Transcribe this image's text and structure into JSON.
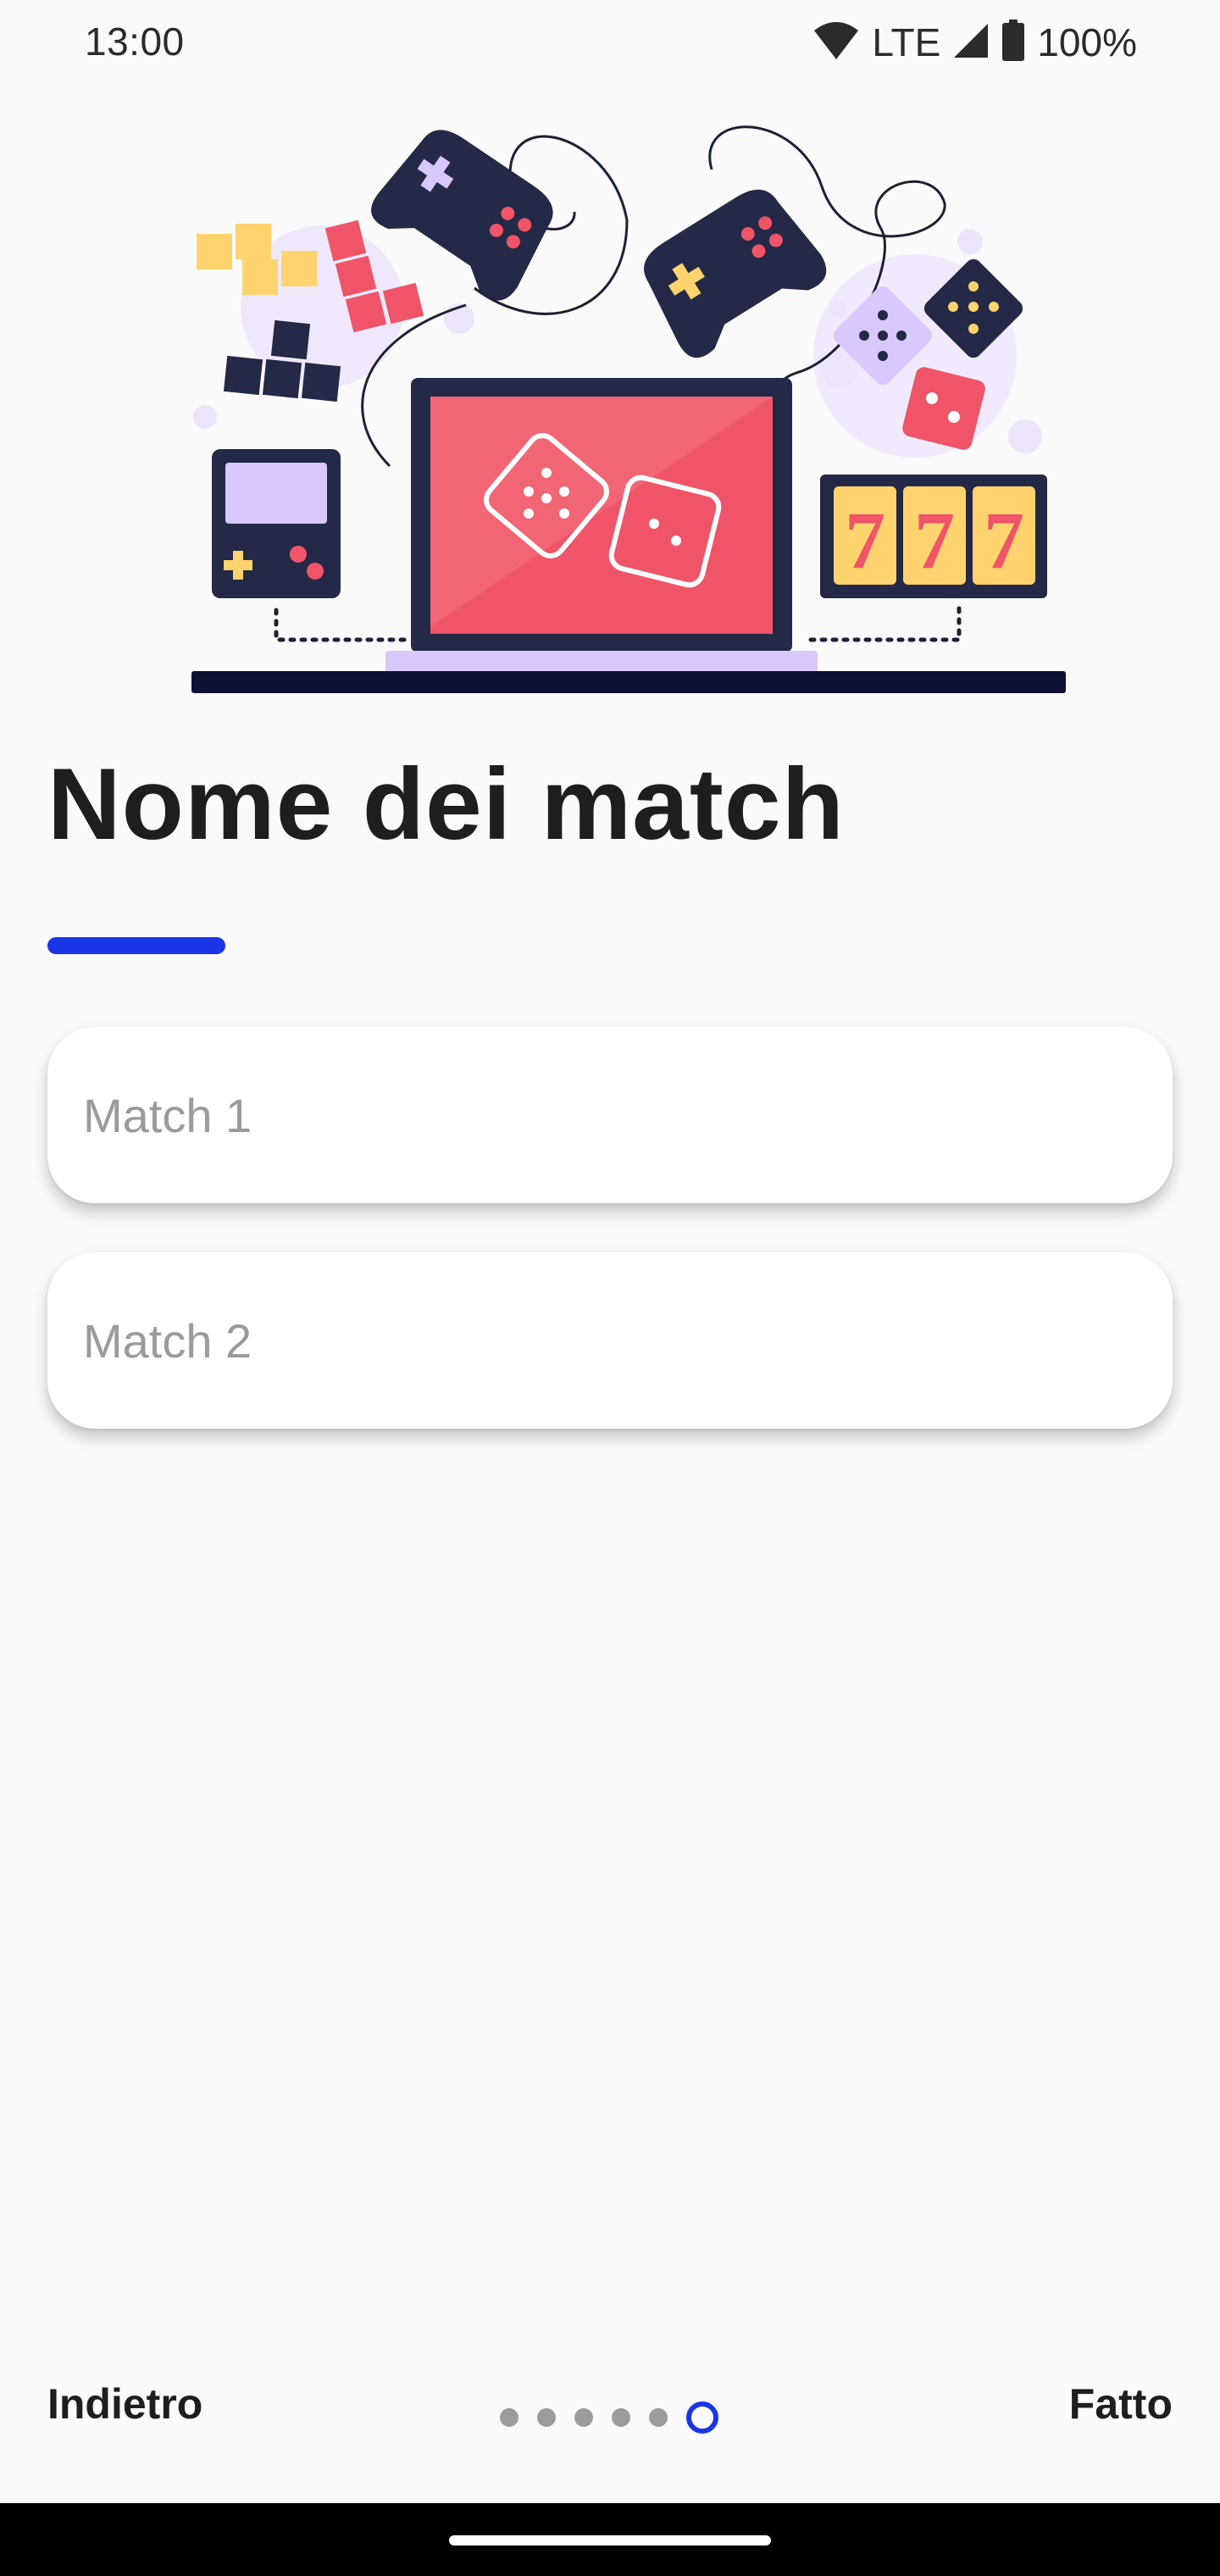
{
  "status_bar": {
    "time": "13:00",
    "network": "LTE",
    "battery": "100%",
    "icons": [
      "wifi-icon",
      "signal-icon",
      "battery-icon"
    ]
  },
  "illustration": {
    "name": "gaming-illustration",
    "slot_text": "777"
  },
  "page": {
    "title": "Nome dei match"
  },
  "fields": [
    {
      "placeholder": "Match 1",
      "value": ""
    },
    {
      "placeholder": "Match 2",
      "value": ""
    }
  ],
  "footer": {
    "back_label": "Indietro",
    "done_label": "Fatto",
    "pages_total": 6,
    "current_page": 6
  },
  "colors": {
    "accent": "#1a35e8",
    "background": "#fafafa",
    "title": "#1e1e1e",
    "navy": "#232946",
    "red": "#ef4f63",
    "yellow": "#ffd36e",
    "lavender": "#d9c8fb"
  }
}
